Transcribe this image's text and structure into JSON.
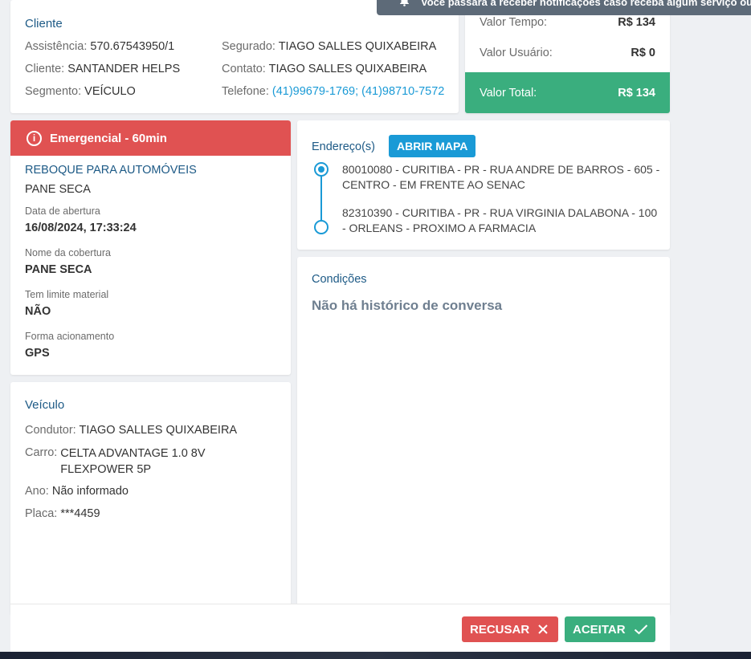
{
  "toast": {
    "text": "Você passará a receber notificações caso receba algum serviço ou haja"
  },
  "cliente": {
    "title": "Cliente",
    "assistencia_label": "Assistência:",
    "assistencia_value": "570.67543950/1",
    "cliente_label": "Cliente:",
    "cliente_value": "SANTANDER HELPS",
    "segmento_label": "Segmento:",
    "segmento_value": "VEÍCULO",
    "segurado_label": "Segurado:",
    "segurado_value": "TIAGO SALLES QUIXABEIRA",
    "contato_label": "Contato:",
    "contato_value": "TIAGO SALLES QUIXABEIRA",
    "telefone_label": "Telefone:",
    "telefone_value": "(41)99679-1769; (41)98710-7572"
  },
  "valores": {
    "tempo_label": "Valor Tempo:",
    "tempo_value": "R$ 134",
    "usuario_label": "Valor Usuário:",
    "usuario_value": "R$ 0",
    "total_label": "Valor Total:",
    "total_value": "R$ 134",
    "total_color": "#3aae7e"
  },
  "servico": {
    "emergency_label": "Emergencial - 60min",
    "emergency_color": "#e05252",
    "tipo": "REBOQUE PARA AUTOMÓVEIS",
    "problema": "PANE SECA",
    "fields": [
      {
        "label": "Data de abertura",
        "value": "16/08/2024, 17:33:24"
      },
      {
        "label": "Nome da cobertura",
        "value": "PANE SECA"
      },
      {
        "label": "Tem limite material",
        "value": "NÃO"
      },
      {
        "label": "Forma acionamento",
        "value": "GPS"
      }
    ]
  },
  "veiculo": {
    "title": "Veículo",
    "condutor_label": "Condutor:",
    "condutor_value": "TIAGO SALLES QUIXABEIRA",
    "carro_label": "Carro:",
    "carro_value": "CELTA ADVANTAGE 1.0 8V FLEXPOWER 5P",
    "ano_label": "Ano:",
    "ano_value": "Não informado",
    "placa_label": "Placa:",
    "placa_value": "***4459"
  },
  "enderecos": {
    "title": "Endereço(s)",
    "map_button": "ABRIR MAPA",
    "items": [
      "80010080 - CURITIBA - PR - RUA ANDRE DE BARROS - 605 - CENTRO - EM FRENTE AO SENAC",
      "82310390 - CURITIBA - PR - RUA VIRGINIA DALABONA - 100 - ORLEANS - PROXIMO A FARMACIA"
    ]
  },
  "condicoes": {
    "title": "Condições",
    "empty_text": "Não há histórico de conversa"
  },
  "actions": {
    "recusar": "RECUSAR",
    "aceitar": "ACEITAR"
  },
  "icons": [
    "bell-icon",
    "info-circle-icon",
    "timeline-start-icon",
    "timeline-end-icon",
    "close-icon",
    "check-icon"
  ]
}
